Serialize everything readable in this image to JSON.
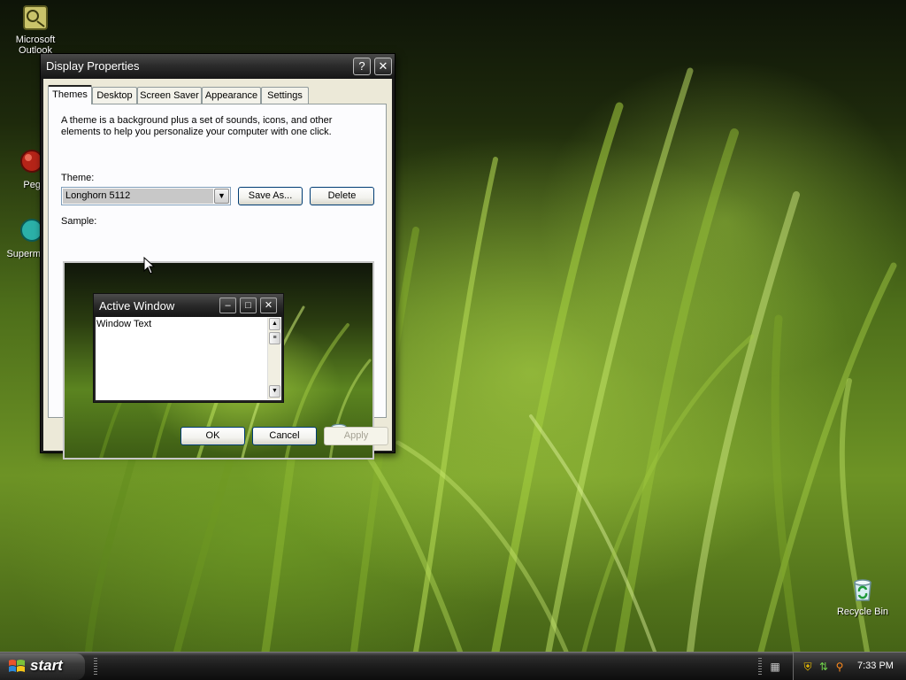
{
  "desktop": {
    "icons": [
      {
        "label": "Microsoft Outlook",
        "icon": "outlook-icon"
      },
      {
        "label": "Peg",
        "icon": "pegasus-icon"
      },
      {
        "label": "Superm",
        "icon": "supermarket-icon"
      },
      {
        "label": "Recycle Bin",
        "icon": "recycle-bin-icon"
      }
    ]
  },
  "dialog": {
    "title": "Display Properties",
    "help_button": "?",
    "close_button": "✕",
    "tabs": [
      {
        "label": "Themes",
        "active": true
      },
      {
        "label": "Desktop",
        "active": false
      },
      {
        "label": "Screen Saver",
        "active": false
      },
      {
        "label": "Appearance",
        "active": false
      },
      {
        "label": "Settings",
        "active": false
      }
    ],
    "description": "A theme is a background plus a set of sounds, icons, and other elements to help you personalize your computer with one click.",
    "theme_label": "Theme:",
    "theme_value": "Longhorn 5112",
    "save_as_label": "Save As...",
    "delete_label": "Delete",
    "sample_label": "Sample:",
    "sample": {
      "window_title": "Active Window",
      "window_text": "Window Text"
    },
    "ok_label": "OK",
    "cancel_label": "Cancel",
    "apply_label": "Apply"
  },
  "taskbar": {
    "start_label": "start",
    "clock": "7:33 PM"
  },
  "colors": {
    "dialog_face": "#ece9d8",
    "title_bar": "#2c2c2c",
    "wallpaper_accent": "#8dbb2e"
  }
}
